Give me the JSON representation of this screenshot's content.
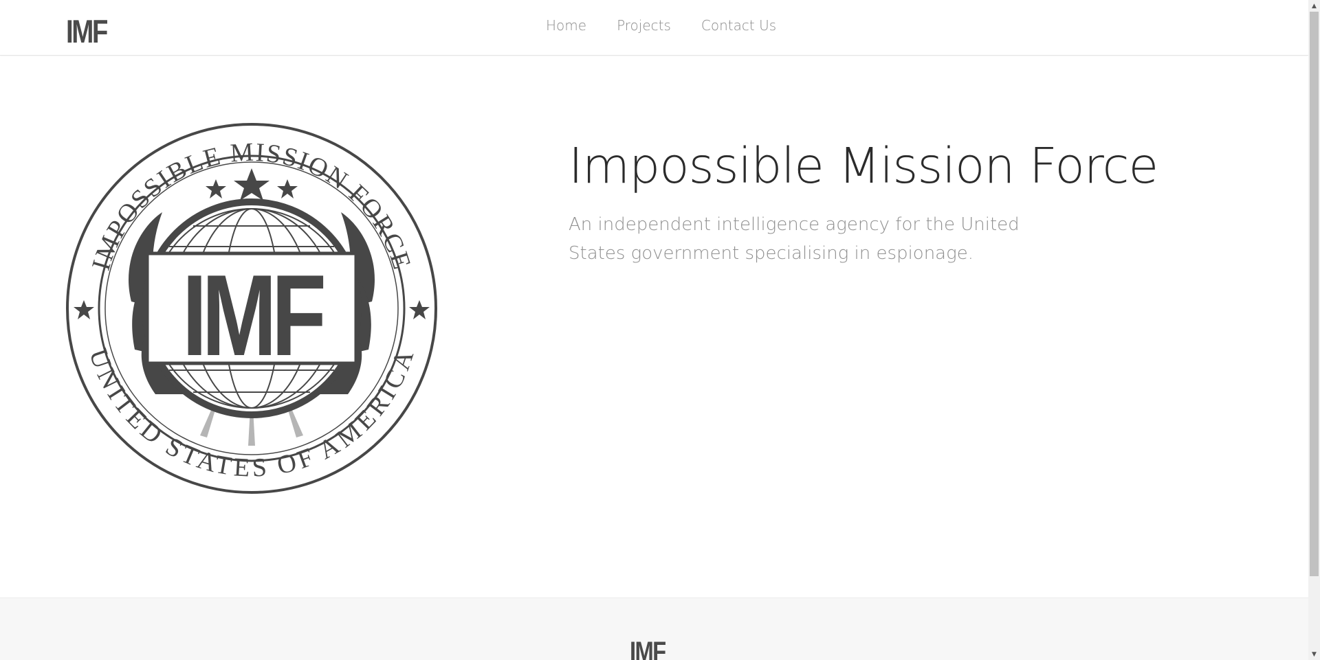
{
  "header": {
    "brand": "IMF",
    "nav": [
      {
        "label": "Home"
      },
      {
        "label": "Projects"
      },
      {
        "label": "Contact Us"
      }
    ]
  },
  "hero": {
    "title": "Impossible Mission Force",
    "subtitle": "An independent intelligence agency for the United States government specialising in espionage.",
    "seal": {
      "top_text": "IMPOSSIBLE MISSION FORCE",
      "bottom_text": "UNITED STATES OF AMERICA",
      "center_text": "IMF"
    }
  },
  "footer": {
    "brand": "IMF"
  },
  "colors": {
    "seal": "#474747",
    "footer_bg": "#f7f7f7",
    "nav_text": "#8a8a8a"
  }
}
